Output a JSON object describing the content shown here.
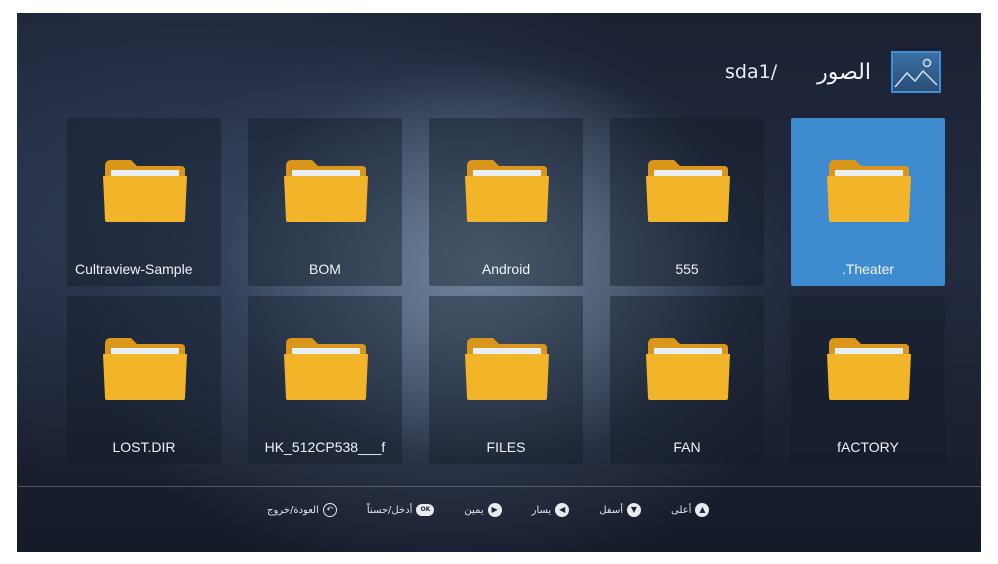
{
  "header": {
    "path": "sda1/",
    "title": "الصور",
    "icon": "picture-icon"
  },
  "folders": [
    {
      "label": "Cultraview-Sample",
      "selected": false
    },
    {
      "label": "BOM",
      "selected": false
    },
    {
      "label": "Android",
      "selected": false
    },
    {
      "label": "555",
      "selected": false
    },
    {
      "label": ".Theater",
      "selected": true
    },
    {
      "label": "LOST.DIR",
      "selected": false
    },
    {
      "label": "HK_512CP538___f",
      "selected": false
    },
    {
      "label": "FILES",
      "selected": false
    },
    {
      "label": "FAN",
      "selected": false
    },
    {
      "label": "fACTORY",
      "selected": false
    }
  ],
  "help_bar": [
    {
      "label": "العودة/خروج",
      "icon": "back-icon"
    },
    {
      "label": "أدخل/حسناً",
      "icon": "ok-icon"
    },
    {
      "label": "يمين",
      "icon": "right-arrow-icon"
    },
    {
      "label": "يسار",
      "icon": "left-arrow-icon"
    },
    {
      "label": "أسفل",
      "icon": "down-arrow-icon"
    },
    {
      "label": "أعلى",
      "icon": "up-arrow-icon"
    }
  ],
  "colors": {
    "selected_tile": "#3e8ccf",
    "folder": "#f2b428",
    "background": "#1f2638"
  }
}
